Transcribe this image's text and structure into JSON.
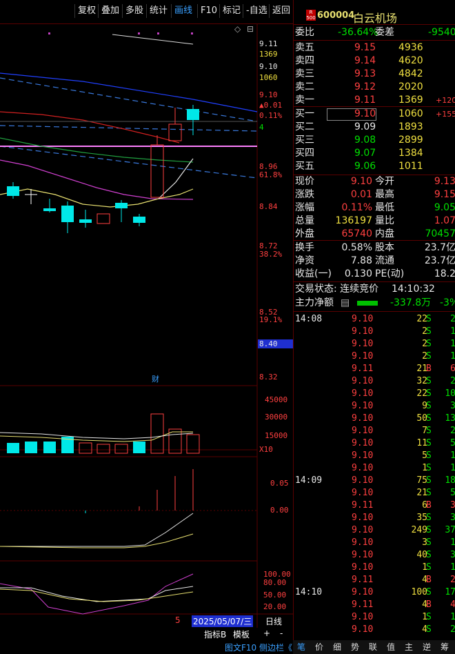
{
  "toolbar": {
    "buttons": [
      "复权",
      "叠加",
      "多股",
      "统计",
      "画线",
      "F10",
      "标记",
      "-自选",
      "返回"
    ]
  },
  "chart": {
    "price_labels": [
      {
        "text": "9.11",
        "cls": "wht"
      },
      {
        "text": "1369",
        "cls": "yel"
      },
      {
        "text": "9.10",
        "cls": "wht"
      },
      {
        "text": "1060",
        "cls": "yel"
      },
      {
        "text": "9.10",
        "cls": "red"
      },
      {
        "text": "▲0.01",
        "cls": "red"
      },
      {
        "text": "0.11%",
        "cls": "red"
      },
      {
        "text": "4",
        "cls": "grn"
      },
      {
        "text": "8.96",
        "cls": "red"
      },
      {
        "text": "61.8%",
        "cls": "red"
      },
      {
        "text": "8.84",
        "cls": "red"
      },
      {
        "text": "8.72",
        "cls": "red"
      },
      {
        "text": "38.2%",
        "cls": "red"
      },
      {
        "text": "8.52",
        "cls": "red"
      },
      {
        "text": "19.1%",
        "cls": "red"
      },
      {
        "text": "8.40",
        "cls": "wht"
      },
      {
        "text": "8.32",
        "cls": "red"
      }
    ],
    "cai_label": "财",
    "vol_axis": [
      "45000",
      "30000",
      "15000",
      "X10"
    ],
    "macd_axis": [
      "0.05",
      "0.00"
    ],
    "kdj_axis": [
      "100.00",
      "80.00",
      "50.00",
      "20.00"
    ],
    "date_label": "2025/05/07/三",
    "num_label": "5",
    "period_label": "日线",
    "bottom_buttons": [
      "指标B",
      "模板",
      "+",
      "-"
    ],
    "status_text": "图文F10 侧边栏《"
  },
  "quote": {
    "code_badge_top": "R",
    "code_badge_bottom": "500",
    "code": "600004",
    "name": "白云机场",
    "weibi_label": "委比",
    "weibi_value": "-36.64%",
    "weicha_label": "委差",
    "weicha_value": "-9540",
    "sells": [
      {
        "label": "卖五",
        "price": "9.15",
        "vol": "4936",
        "chg": ""
      },
      {
        "label": "卖四",
        "price": "9.14",
        "vol": "4620",
        "chg": ""
      },
      {
        "label": "卖三",
        "price": "9.13",
        "vol": "4842",
        "chg": ""
      },
      {
        "label": "卖二",
        "price": "9.12",
        "vol": "2020",
        "chg": ""
      },
      {
        "label": "卖一",
        "price": "9.11",
        "vol": "1369",
        "chg": "+120"
      }
    ],
    "buys": [
      {
        "label": "买一",
        "price": "9.10",
        "vol": "1060",
        "chg": "+155",
        "pcls": "red"
      },
      {
        "label": "买二",
        "price": "9.09",
        "vol": "1893",
        "chg": "",
        "pcls": "wht"
      },
      {
        "label": "买三",
        "price": "9.08",
        "vol": "2899",
        "chg": "",
        "pcls": "grn"
      },
      {
        "label": "买四",
        "price": "9.07",
        "vol": "1384",
        "chg": "",
        "pcls": "grn"
      },
      {
        "label": "买五",
        "price": "9.06",
        "vol": "1011",
        "chg": "",
        "pcls": "grn"
      }
    ],
    "stats": [
      {
        "l1": "现价",
        "v1": "9.10",
        "c1": "red",
        "l2": "今开",
        "v2": "9.13",
        "c2": "red"
      },
      {
        "l1": "涨跌",
        "v1": "0.01",
        "c1": "red",
        "l2": "最高",
        "v2": "9.15",
        "c2": "red"
      },
      {
        "l1": "涨幅",
        "v1": "0.11%",
        "c1": "red",
        "l2": "最低",
        "v2": "9.05",
        "c2": "grn"
      },
      {
        "l1": "总量",
        "v1": "136197",
        "c1": "yel",
        "l2": "量比",
        "v2": "1.07",
        "c2": "red"
      },
      {
        "l1": "外盘",
        "v1": "65740",
        "c1": "red",
        "l2": "内盘",
        "v2": "70457",
        "c2": "grn"
      }
    ],
    "stats2": [
      {
        "l1": "换手",
        "v1": "0.58%",
        "c1": "wht",
        "l2": "股本",
        "v2": "23.7亿",
        "c2": "wht"
      },
      {
        "l1": "净资",
        "v1": "7.88",
        "c1": "wht",
        "l2": "流通",
        "v2": "23.7亿",
        "c2": "wht"
      },
      {
        "l1": "收益(一)",
        "v1": "0.130",
        "c1": "wht",
        "l2": "PE(动)",
        "v2": "18.2",
        "c2": "wht"
      }
    ],
    "trade_status": "交易状态: 连续竞价",
    "trade_time": "14:10:32",
    "main_flow_label": "主力净额",
    "main_flow_value": "-337.8万",
    "main_flow_pct": "-3%",
    "ticks": [
      {
        "t": "14:08",
        "p": "9.10",
        "pc": "red",
        "v": "22",
        "s": "S",
        "n": "2"
      },
      {
        "t": "",
        "p": "9.10",
        "pc": "red",
        "v": "2",
        "s": "S",
        "n": "1"
      },
      {
        "t": "",
        "p": "9.10",
        "pc": "red",
        "v": "2",
        "s": "S",
        "n": "1"
      },
      {
        "t": "",
        "p": "9.10",
        "pc": "red",
        "v": "2",
        "s": "S",
        "n": "1"
      },
      {
        "t": "",
        "p": "9.11",
        "pc": "red",
        "v": "21",
        "s": "B",
        "n": "6"
      },
      {
        "t": "",
        "p": "9.10",
        "pc": "red",
        "v": "32",
        "s": "S",
        "n": "2"
      },
      {
        "t": "",
        "p": "9.10",
        "pc": "red",
        "v": "22",
        "s": "S",
        "n": "10"
      },
      {
        "t": "",
        "p": "9.10",
        "pc": "red",
        "v": "9",
        "s": "S",
        "n": "3"
      },
      {
        "t": "",
        "p": "9.10",
        "pc": "red",
        "v": "50",
        "s": "S",
        "n": "13"
      },
      {
        "t": "",
        "p": "9.10",
        "pc": "red",
        "v": "7",
        "s": "S",
        "n": "2"
      },
      {
        "t": "",
        "p": "9.10",
        "pc": "red",
        "v": "11",
        "s": "S",
        "n": "5"
      },
      {
        "t": "",
        "p": "9.10",
        "pc": "red",
        "v": "5",
        "s": "S",
        "n": "1"
      },
      {
        "t": "",
        "p": "9.10",
        "pc": "red",
        "v": "1",
        "s": "S",
        "n": "1"
      },
      {
        "t": "14:09",
        "p": "9.10",
        "pc": "red",
        "v": "75",
        "s": "S",
        "n": "18"
      },
      {
        "t": "",
        "p": "9.10",
        "pc": "red",
        "v": "21",
        "s": "S",
        "n": "5"
      },
      {
        "t": "",
        "p": "9.11",
        "pc": "red",
        "v": "6",
        "s": "B",
        "n": "3"
      },
      {
        "t": "",
        "p": "9.10",
        "pc": "red",
        "v": "35",
        "s": "S",
        "n": "3"
      },
      {
        "t": "",
        "p": "9.10",
        "pc": "red",
        "v": "249",
        "s": "S",
        "n": "37"
      },
      {
        "t": "",
        "p": "9.10",
        "pc": "red",
        "v": "3",
        "s": "S",
        "n": "1"
      },
      {
        "t": "",
        "p": "9.10",
        "pc": "red",
        "v": "40",
        "s": "S",
        "n": "3"
      },
      {
        "t": "",
        "p": "9.10",
        "pc": "red",
        "v": "1",
        "s": "S",
        "n": "1"
      },
      {
        "t": "",
        "p": "9.11",
        "pc": "red",
        "v": "4",
        "s": "B",
        "n": "2"
      },
      {
        "t": "14:10",
        "p": "9.10",
        "pc": "red",
        "v": "100",
        "s": "S",
        "n": "17"
      },
      {
        "t": "",
        "p": "9.11",
        "pc": "red",
        "v": "4",
        "s": "B",
        "n": "4"
      },
      {
        "t": "",
        "p": "9.10",
        "pc": "red",
        "v": "1",
        "s": "S",
        "n": "1"
      },
      {
        "t": "",
        "p": "9.10",
        "pc": "red",
        "v": "4",
        "s": "S",
        "n": "2"
      }
    ],
    "tabs": [
      "笔",
      "价",
      "细",
      "势",
      "联",
      "值",
      "主",
      "逆",
      "筹"
    ]
  }
}
